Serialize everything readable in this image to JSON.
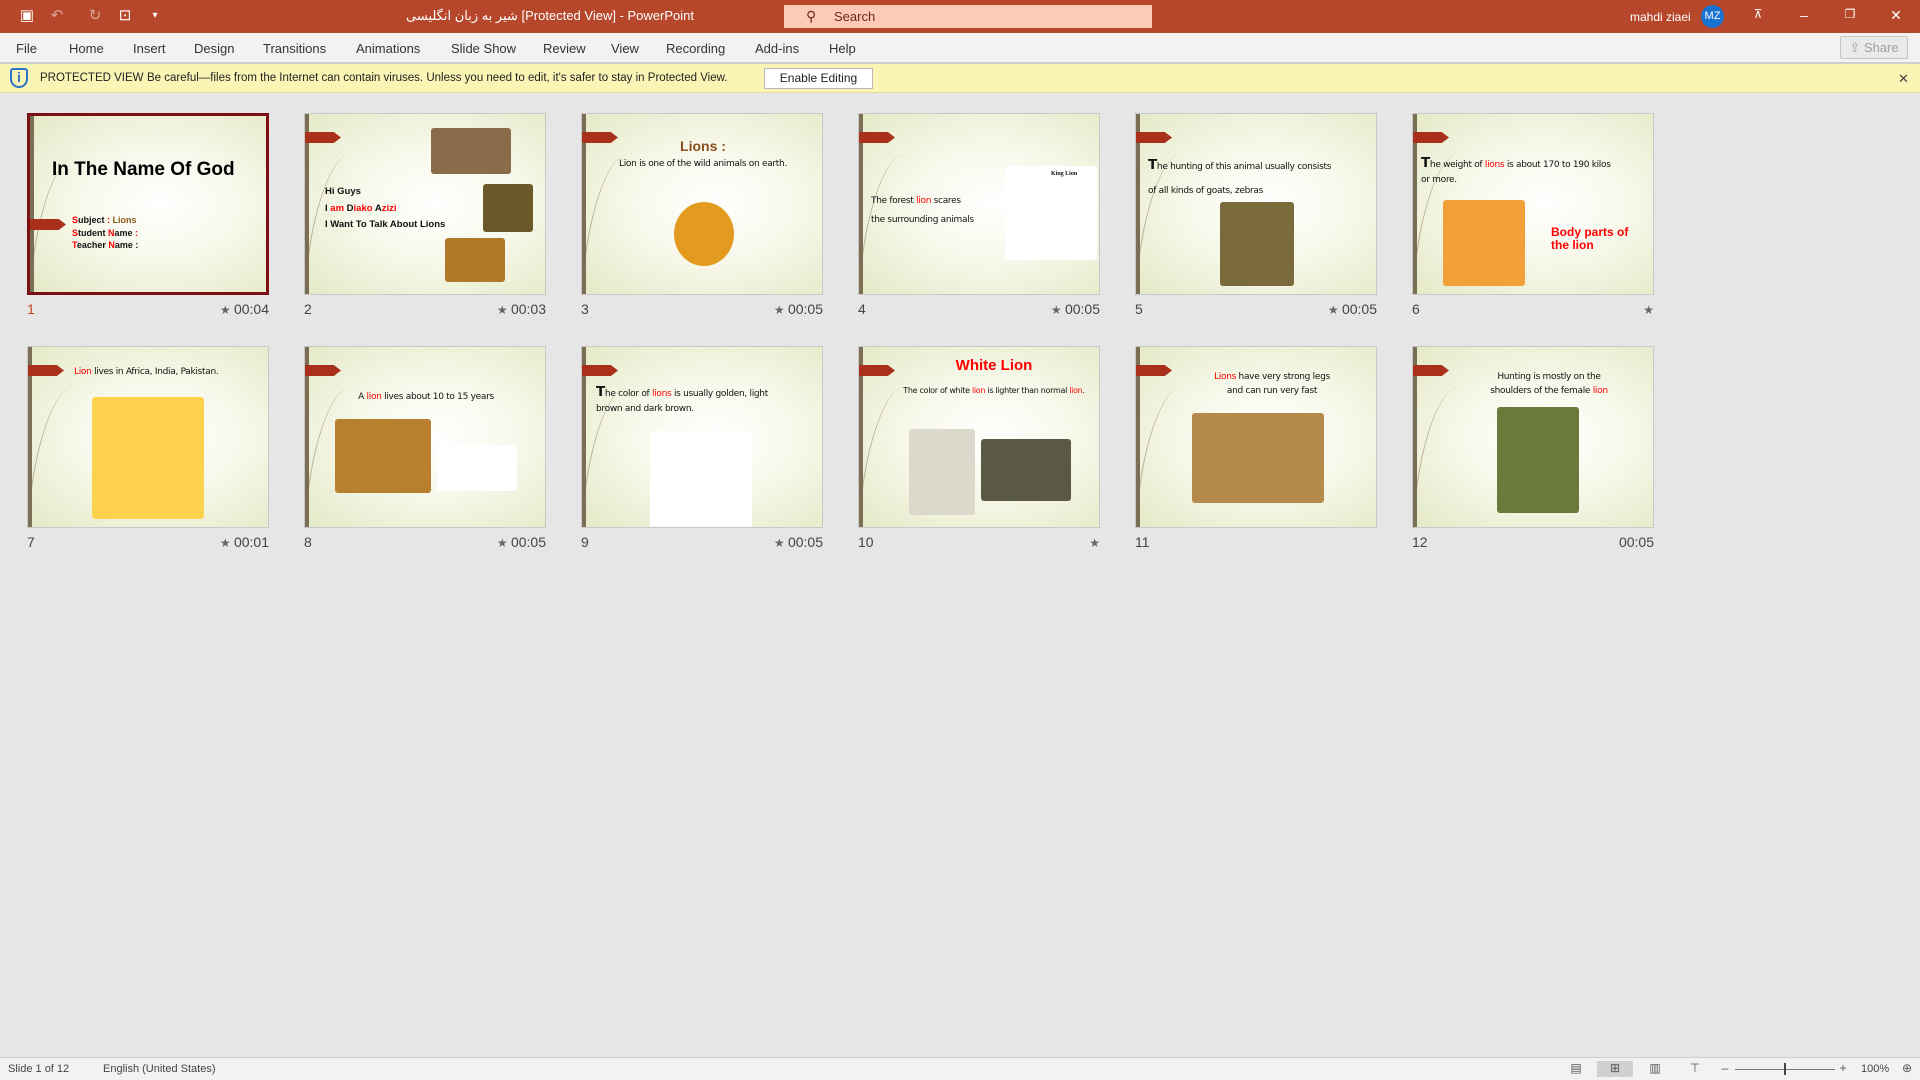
{
  "titlebar": {
    "title": "شیر به زبان انگلیسی [Protected View]  -  PowerPoint",
    "search_placeholder": "Search",
    "user_name": "mahdi ziaei",
    "user_initials": "MZ",
    "icons": [
      "save-icon",
      "undo-icon",
      "redo-icon",
      "present-from-start-icon",
      "customize-qat-icon"
    ]
  },
  "menu": {
    "items": [
      "File",
      "Home",
      "Insert",
      "Design",
      "Transitions",
      "Animations",
      "Slide Show",
      "Review",
      "View",
      "Recording",
      "Add-ins",
      "Help"
    ],
    "share": "Share"
  },
  "protected": {
    "title": "PROTECTED VIEW",
    "message": "Be careful—files from the Internet can contain viruses. Unless you need to edit, it's safer to stay in Protected View.",
    "button": "Enable Editing"
  },
  "colors": {
    "accent": "#b7472a",
    "selected_border": "#7a0f14",
    "highlight_red": "#ff0000",
    "tab": "#a9301a"
  },
  "slides": [
    {
      "num": "1",
      "duration": "00:04",
      "star": true,
      "title": "In The Name Of God",
      "lines": [
        [
          {
            "t": "S",
            "r": 1
          },
          {
            "t": "ubject "
          },
          {
            "t": ": ",
            "r": 1
          },
          {
            "t": "Lions",
            "c": "#8a5a1a"
          }
        ],
        [
          {
            "t": "S",
            "r": 1
          },
          {
            "t": "tudent "
          },
          {
            "t": "N",
            "r": 1
          },
          {
            "t": "ame "
          },
          {
            "t": ":",
            "r": 1
          }
        ],
        [
          {
            "t": "T",
            "r": 1
          },
          {
            "t": "eacher "
          },
          {
            "t": "N",
            "r": 1
          },
          {
            "t": "ame :"
          }
        ]
      ]
    },
    {
      "num": "2",
      "duration": "00:03",
      "star": true,
      "lines": [
        [
          {
            "t": "Hi Guys"
          }
        ],
        [
          {
            "t": "I "
          },
          {
            "t": "am ",
            "r": 1
          },
          {
            "t": "D"
          },
          {
            "t": "iako ",
            "r": 1
          },
          {
            "t": "A"
          },
          {
            "t": "zizi",
            "r": 1
          }
        ],
        [
          {
            "t": "I Want To Talk About Lions"
          }
        ]
      ]
    },
    {
      "num": "3",
      "duration": "00:05",
      "star": true,
      "title": "Lions :",
      "lines": [
        [
          {
            "t": "Lion is one of the wild animals on earth."
          }
        ]
      ]
    },
    {
      "num": "4",
      "duration": "00:05",
      "star": true,
      "image_caption": "King Lion",
      "lines": [
        [
          {
            "t": "The forest "
          },
          {
            "t": "lion",
            "r": 1
          },
          {
            "t": " scares"
          }
        ],
        [
          {
            "t": "the surrounding animals"
          }
        ]
      ]
    },
    {
      "num": "5",
      "duration": "00:05",
      "star": true,
      "lines": [
        [
          {
            "t": "T",
            "big": 1
          },
          {
            "t": "he hunting of this animal usually consists"
          }
        ],
        [
          {
            "t": "of all kinds of goats, zebras"
          }
        ]
      ]
    },
    {
      "num": "6",
      "duration": "",
      "star": true,
      "title": "Body parts of the lion",
      "lines": [
        [
          {
            "t": "T",
            "big": 1
          },
          {
            "t": "he weight of "
          },
          {
            "t": "lions",
            "r": 1
          },
          {
            "t": " is about 170 to 190 kilos"
          }
        ],
        [
          {
            "t": "or more."
          }
        ]
      ]
    },
    {
      "num": "7",
      "duration": "00:01",
      "star": true,
      "lines": [
        [
          {
            "t": "Lion",
            "r": 1
          },
          {
            "t": " lives in Africa, India, Pakistan."
          }
        ]
      ]
    },
    {
      "num": "8",
      "duration": "00:05",
      "star": true,
      "lines": [
        [
          {
            "t": "A "
          },
          {
            "t": "lion",
            "r": 1
          },
          {
            "t": " lives about 10 to 15 years"
          }
        ]
      ]
    },
    {
      "num": "9",
      "duration": "00:05",
      "star": true,
      "lines": [
        [
          {
            "t": "T",
            "big": 1
          },
          {
            "t": "he color of "
          },
          {
            "t": "lions",
            "r": 1
          },
          {
            "t": " is usually golden, light"
          }
        ],
        [
          {
            "t": "brown and dark brown."
          }
        ]
      ]
    },
    {
      "num": "10",
      "duration": "",
      "star": true,
      "title": "White Lion",
      "lines": [
        [
          {
            "t": "The color of white "
          },
          {
            "t": "lion",
            "r": 1
          },
          {
            "t": " is lighter than normal "
          },
          {
            "t": "lion",
            "r": 1
          },
          {
            "t": "."
          }
        ]
      ]
    },
    {
      "num": "11",
      "duration": "",
      "star": false,
      "lines": [
        [
          {
            "t": "Lions",
            "r": 1
          },
          {
            "t": " have very strong legs"
          }
        ],
        [
          {
            "t": "and can run very fast"
          }
        ]
      ]
    },
    {
      "num": "12",
      "duration": "00:05",
      "star": false,
      "lines": [
        [
          {
            "t": "Hunting is mostly on the"
          }
        ],
        [
          {
            "t": "shoulders of the female "
          },
          {
            "t": "lion",
            "r": 1
          }
        ]
      ]
    }
  ],
  "status": {
    "slide_info": "Slide 1 of 12",
    "language": "English (United States)",
    "zoom": "100%",
    "zoom_level": 100
  }
}
